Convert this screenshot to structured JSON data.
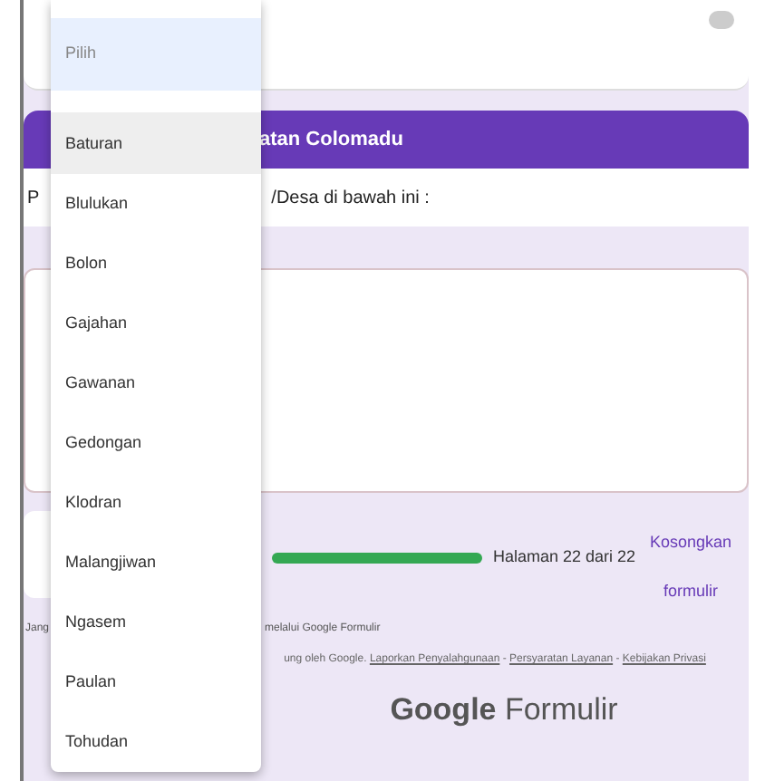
{
  "section_header": {
    "title": "atan Colomadu"
  },
  "instruction": {
    "parts": [
      "P",
      "/Desa di bawah ini :"
    ]
  },
  "progress": {
    "label": "Halaman 22 dari 22"
  },
  "clear_button": {
    "label": "Kosongkan formulir"
  },
  "footer": {
    "notice_parts": [
      "Jang",
      "melalui Google Formulir"
    ],
    "legal_text": "ung oleh Google.",
    "links": [
      "Laporkan Penyalahgunaan",
      "Persyaratan Layanan",
      "Kebijakan Privasi"
    ],
    "separator": "-",
    "brand": "**Google** Formulir"
  },
  "dropdown": {
    "options": [
      {
        "label": "Pilih",
        "selected": true,
        "highlighted": false
      },
      {
        "label": "Baturan",
        "selected": false,
        "highlighted": true
      },
      {
        "label": "Blulukan",
        "selected": false,
        "highlighted": false
      },
      {
        "label": "Bolon",
        "selected": false,
        "highlighted": false
      },
      {
        "label": "Gajahan",
        "selected": false,
        "highlighted": false
      },
      {
        "label": "Gawanan",
        "selected": false,
        "highlighted": false
      },
      {
        "label": "Gedongan",
        "selected": false,
        "highlighted": false
      },
      {
        "label": "Klodran",
        "selected": false,
        "highlighted": false
      },
      {
        "label": "Malangjiwan",
        "selected": false,
        "highlighted": false
      },
      {
        "label": "Ngasem",
        "selected": false,
        "highlighted": false
      },
      {
        "label": "Paulan",
        "selected": false,
        "highlighted": false
      },
      {
        "label": "Tohudan",
        "selected": false,
        "highlighted": false
      }
    ]
  }
}
